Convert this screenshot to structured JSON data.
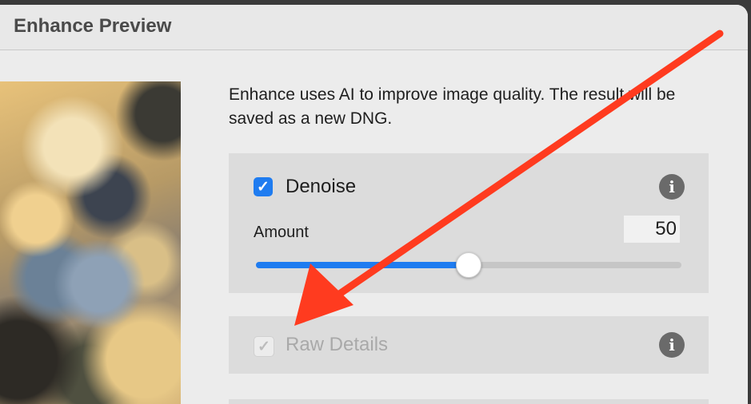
{
  "dialog": {
    "title": "Enhance Preview"
  },
  "description": "Enhance uses AI to improve image quality. The result will be saved as a new DNG.",
  "denoise": {
    "label": "Denoise",
    "checked": true,
    "amount_label": "Amount",
    "amount_value": "50",
    "slider_fraction": 0.5
  },
  "raw_details": {
    "label": "Raw Details",
    "checked": true,
    "disabled": true
  },
  "icons": {
    "checkmark": "✓",
    "info": "i"
  },
  "colors": {
    "accent": "#1f7cf0",
    "arrow": "#ff3b1f",
    "panel": "#dcdcdc"
  }
}
